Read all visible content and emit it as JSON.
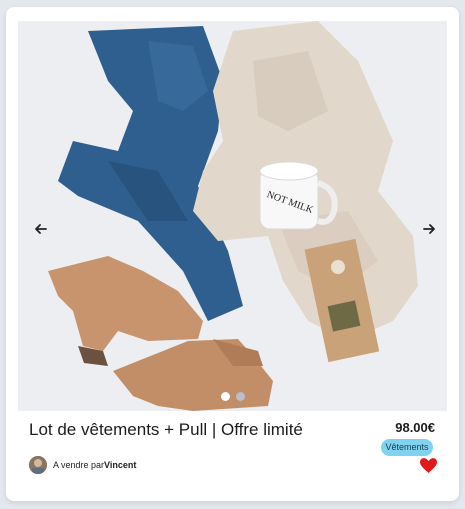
{
  "product": {
    "title": "Lot de vêtements + Pull | Offre limité",
    "price": "98.00€",
    "category": "Vêtements",
    "seller_prefix": "A vendre par",
    "seller_name": "Vincent",
    "favorite": true
  },
  "carousel": {
    "image_count": 2,
    "active_index": 0,
    "mug_text": "NOT MILK"
  },
  "icons": {
    "prev": "arrow-left-icon",
    "next": "arrow-right-icon",
    "favorite": "heart-icon"
  },
  "colors": {
    "tag_background": "#7fd3f0",
    "heart": "#e0191c",
    "card": "#ffffff"
  }
}
